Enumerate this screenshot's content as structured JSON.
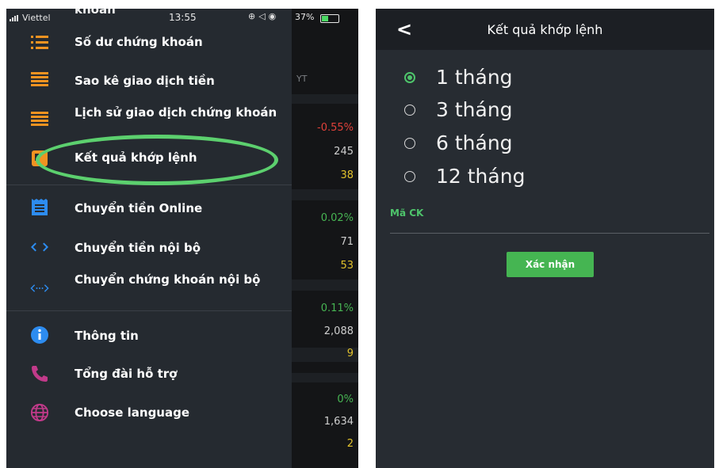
{
  "status_bar": {
    "carrier": "Viettel",
    "time": "13:55",
    "battery": "37%",
    "clipped_text": "khoán"
  },
  "background_screen": {
    "column_header": "YT",
    "values": [
      {
        "text": "-0.55%",
        "color": "#e0413a"
      },
      {
        "text": "245",
        "color": "#cfcfcf"
      },
      {
        "text": "38",
        "color": "#e2c22c"
      },
      {
        "text": "0.02%",
        "color": "#47b553"
      },
      {
        "text": "71",
        "color": "#cfcfcf"
      },
      {
        "text": "53",
        "color": "#e2c22c"
      },
      {
        "text": "0.11%",
        "color": "#47b553"
      },
      {
        "text": "2,088",
        "color": "#cfcfcf"
      },
      {
        "text": "9",
        "color": "#e2c22c"
      },
      {
        "text": "0%",
        "color": "#47b553"
      },
      {
        "text": "1,634",
        "color": "#cfcfcf"
      },
      {
        "text": "2",
        "color": "#e2c22c"
      }
    ]
  },
  "menu": {
    "items": [
      {
        "label": "Số dư chứng khoán",
        "icon": "list-bullet-icon"
      },
      {
        "label": "Sao kê giao dịch tiền",
        "icon": "lines-icon"
      },
      {
        "label": "Lịch sử giao dịch chứng khoán",
        "icon": "lines-icon"
      },
      {
        "label": "Kết quả khớp lệnh",
        "icon": "match-result-icon"
      },
      {
        "label": "Chuyển tiền Online",
        "icon": "receipt-icon"
      },
      {
        "label": "Chuyển tiền nội bộ",
        "icon": "transfer-arrows-icon"
      },
      {
        "label": "Chuyển chứng khoán nội bộ",
        "icon": "dotted-arrows-icon"
      },
      {
        "label": "Thông tin",
        "icon": "info-icon"
      },
      {
        "label": "Tổng đài hỗ trợ",
        "icon": "phone-icon"
      },
      {
        "label": "Choose language",
        "icon": "globe-icon"
      }
    ],
    "highlight_color": "#5cd06e",
    "accent_orange": "#f19321",
    "accent_blue": "#2d8cf0",
    "accent_pink": "#c23a8a"
  },
  "result_screen": {
    "title": "Kết quả khớp lệnh",
    "back_label": "<",
    "options": [
      {
        "label": "1 tháng",
        "selected": true
      },
      {
        "label": "3 tháng",
        "selected": false
      },
      {
        "label": "6 tháng",
        "selected": false
      },
      {
        "label": "12 tháng",
        "selected": false
      }
    ],
    "field_label": "Mã CK",
    "confirm_label": "Xác nhận",
    "accent_green": "#4ec46b"
  }
}
